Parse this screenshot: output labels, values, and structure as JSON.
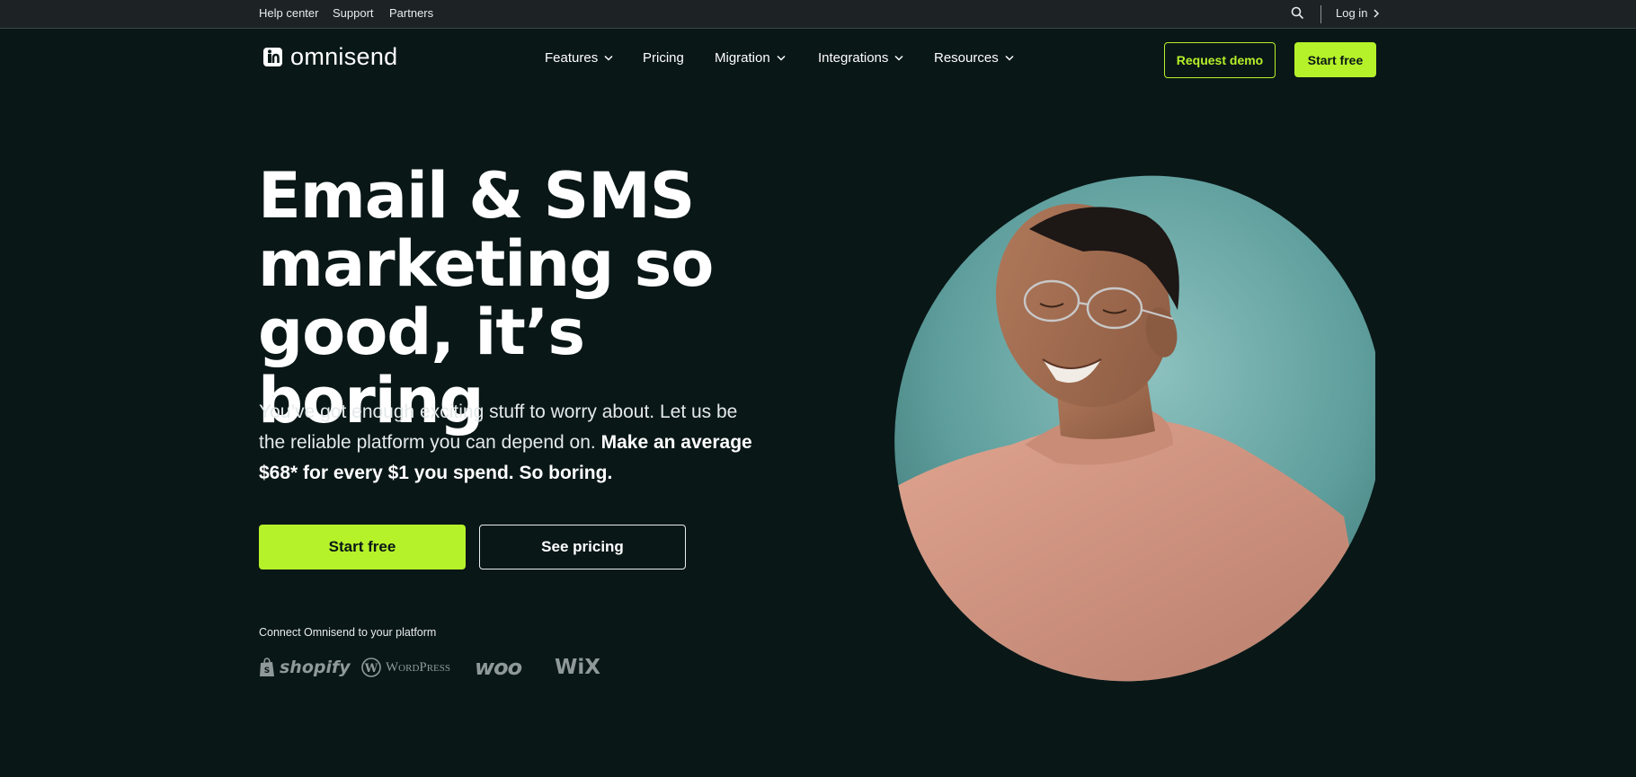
{
  "topbar": {
    "links": [
      "Help center",
      "Support",
      "Partners"
    ],
    "search_icon": "search-icon",
    "login_label": "Log in"
  },
  "brand": {
    "name": "omnisend",
    "accent_color": "#b6f22a",
    "background_color": "#0a1717"
  },
  "nav": {
    "items": [
      {
        "label": "Features",
        "has_dropdown": true
      },
      {
        "label": "Pricing",
        "has_dropdown": false
      },
      {
        "label": "Migration",
        "has_dropdown": true
      },
      {
        "label": "Integrations",
        "has_dropdown": true
      },
      {
        "label": "Resources",
        "has_dropdown": true
      }
    ],
    "request_demo_label": "Request demo",
    "start_free_label": "Start free"
  },
  "hero": {
    "title_lines": [
      "Email & SMS",
      "marketing so",
      "good, it’s boring"
    ],
    "subtitle_regular": "You’ve got enough exciting stuff to worry about. Let us be the reliable platform you can depend on. ",
    "subtitle_bold": "Make an average $68* for every $1 you spend. So boring.",
    "start_free_label": "Start free",
    "see_pricing_label": "See pricing",
    "connect_label": "Connect Omnisend to your platform",
    "platforms": [
      "shopify",
      "WordPress",
      "woo",
      "WiX"
    ]
  }
}
